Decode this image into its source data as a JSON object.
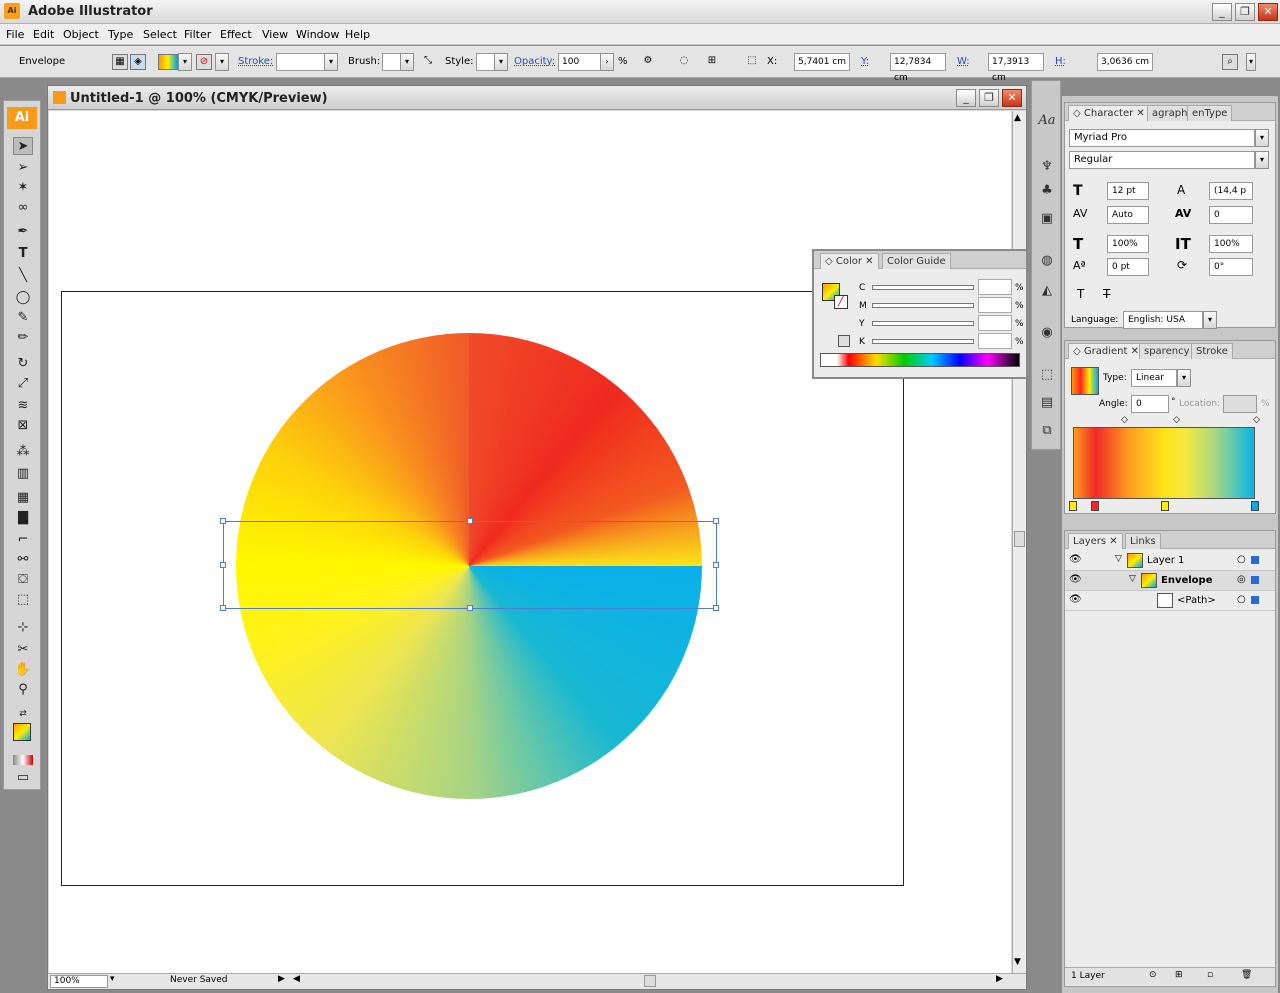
{
  "app": {
    "title": "Adobe Illustrator",
    "icon": "Ai"
  },
  "menu": [
    "File",
    "Edit",
    "Object",
    "Type",
    "Select",
    "Filter",
    "Effect",
    "View",
    "Window",
    "Help"
  ],
  "control": {
    "selection": "Envelope",
    "stroke_label": "Stroke:",
    "brush_label": "Brush:",
    "style_label": "Style:",
    "opacity_label": "Opacity:",
    "opacity_value": "100",
    "opacity_unit": "%",
    "x_label": "X:",
    "x_value": "5,7401 cm",
    "y_label": "Y:",
    "y_value": "12,7834 cm",
    "w_label": "W:",
    "w_value": "17,3913 cm",
    "h_label": "H:",
    "h_value": "3,0636 cm"
  },
  "document": {
    "title": "Untitled-1 @ 100% (CMYK/Preview)",
    "zoom": "100%",
    "status": "Never Saved"
  },
  "colors": {
    "accent": "#4c7cd4",
    "brand": "#f79a1a"
  },
  "tools": [
    "selection-tool",
    "direct-selection-tool",
    "magic-wand-tool",
    "lasso-tool",
    "pen-tool",
    "type-tool",
    "line-tool",
    "ellipse-tool",
    "paintbrush-tool",
    "pencil-tool",
    "rotate-tool",
    "scale-tool",
    "warp-tool",
    "free-transform-tool",
    "symbol-sprayer-tool",
    "column-graph-tool",
    "mesh-tool",
    "gradient-tool",
    "eyedropper-tool",
    "blend-tool",
    "live-paint-tool",
    "live-paint-selection-tool",
    "slice-tool",
    "scissors-tool",
    "hand-tool",
    "zoom-tool"
  ],
  "color_panel": {
    "tabs": [
      "Color",
      "Color Guide"
    ],
    "channels": [
      "C",
      "M",
      "Y",
      "K"
    ],
    "unit": "%"
  },
  "character_panel": {
    "tabs": [
      "Character",
      "agraph",
      "enType"
    ],
    "font": "Myriad Pro",
    "style": "Regular",
    "size": "12 pt",
    "leading": "(14,4 p",
    "kerning": "Auto",
    "tracking": "0",
    "vscale": "100%",
    "hscale": "100%",
    "baseline": "0 pt",
    "rotation": "0°",
    "language_label": "Language:",
    "language": "English: USA"
  },
  "gradient_panel": {
    "tabs": [
      "Gradient",
      "sparency",
      "Stroke"
    ],
    "type_label": "Type:",
    "type": "Linear",
    "angle_label": "Angle:",
    "angle": "0",
    "angle_unit": "°",
    "location_label": "Location:",
    "location_unit": "%"
  },
  "layers_panel": {
    "tabs": [
      "Layers",
      "Links"
    ],
    "rows": [
      {
        "name": "Layer 1"
      },
      {
        "name": "Envelope"
      },
      {
        "name": "<Path>"
      }
    ],
    "footer": "1 Layer"
  }
}
